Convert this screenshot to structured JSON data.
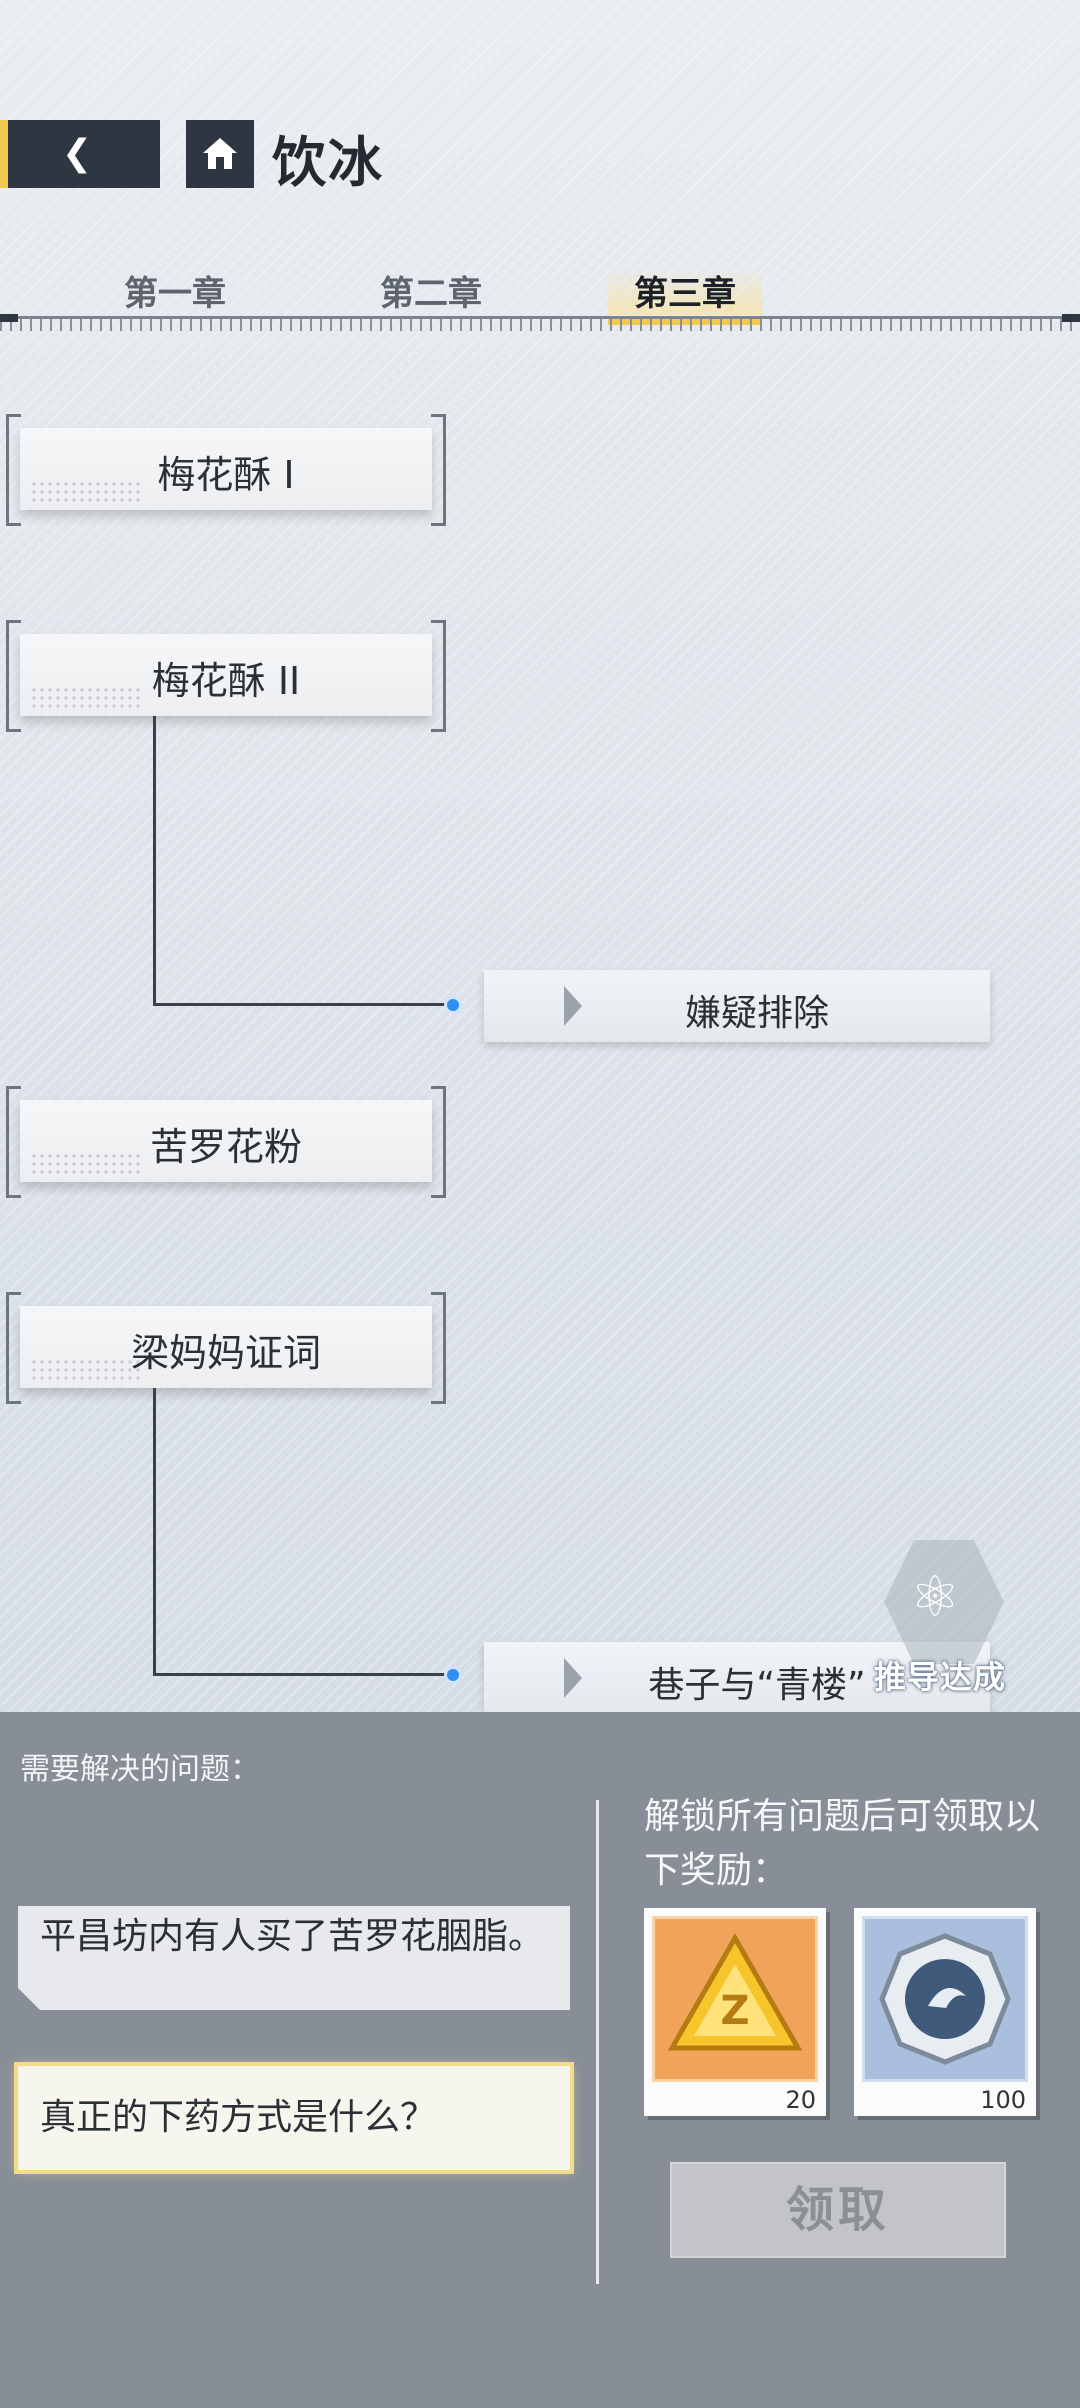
{
  "header": {
    "title": "饮冰"
  },
  "tabs": [
    {
      "label": "第一章"
    },
    {
      "label": "第二章"
    },
    {
      "label": "第三章",
      "active": true
    }
  ],
  "clues": [
    {
      "label": "梅花酥 I"
    },
    {
      "label": "梅花酥 II"
    },
    {
      "label": "苦罗花粉"
    },
    {
      "label": "梁妈妈证词"
    }
  ],
  "deductions": [
    {
      "label": "嫌疑排除"
    },
    {
      "label": "巷子与“青楼”"
    }
  ],
  "badge": {
    "text": "推导达成"
  },
  "panel": {
    "heading": "需要解决的问题：",
    "questions": [
      {
        "text": "平昌坊内有人买了苦罗花胭脂。"
      },
      {
        "text": "真正的下药方式是什么？",
        "selected": true
      }
    ],
    "reward_heading": "解锁所有问题后可领取以下奖励：",
    "rewards": [
      {
        "icon": "golden-triangle-icon",
        "count": "20"
      },
      {
        "icon": "silver-coin-icon",
        "count": "100"
      }
    ],
    "claim_label": "领取"
  },
  "colors": {
    "accent": "#f2c94c",
    "dot": "#2f8ff0",
    "panel": "#878e97"
  }
}
